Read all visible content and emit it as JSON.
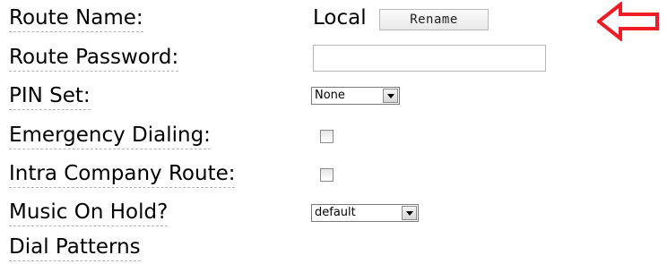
{
  "form": {
    "route_name_label": "Route Name:",
    "route_name_value": "Local",
    "rename_label": "Rename",
    "route_password_label": "Route Password:",
    "route_password_value": "",
    "pin_set_label": "PIN Set:",
    "pin_set_value": "None",
    "emergency_dialing_label": "Emergency Dialing:",
    "emergency_dialing_checked": false,
    "intra_company_label": "Intra Company Route:",
    "intra_company_checked": false,
    "music_on_hold_label": "Music On Hold?",
    "music_on_hold_value": "default",
    "dial_patterns_label": "Dial Patterns"
  },
  "annotation": {
    "icon": "left-arrow-icon",
    "color": "#ee1c24"
  }
}
